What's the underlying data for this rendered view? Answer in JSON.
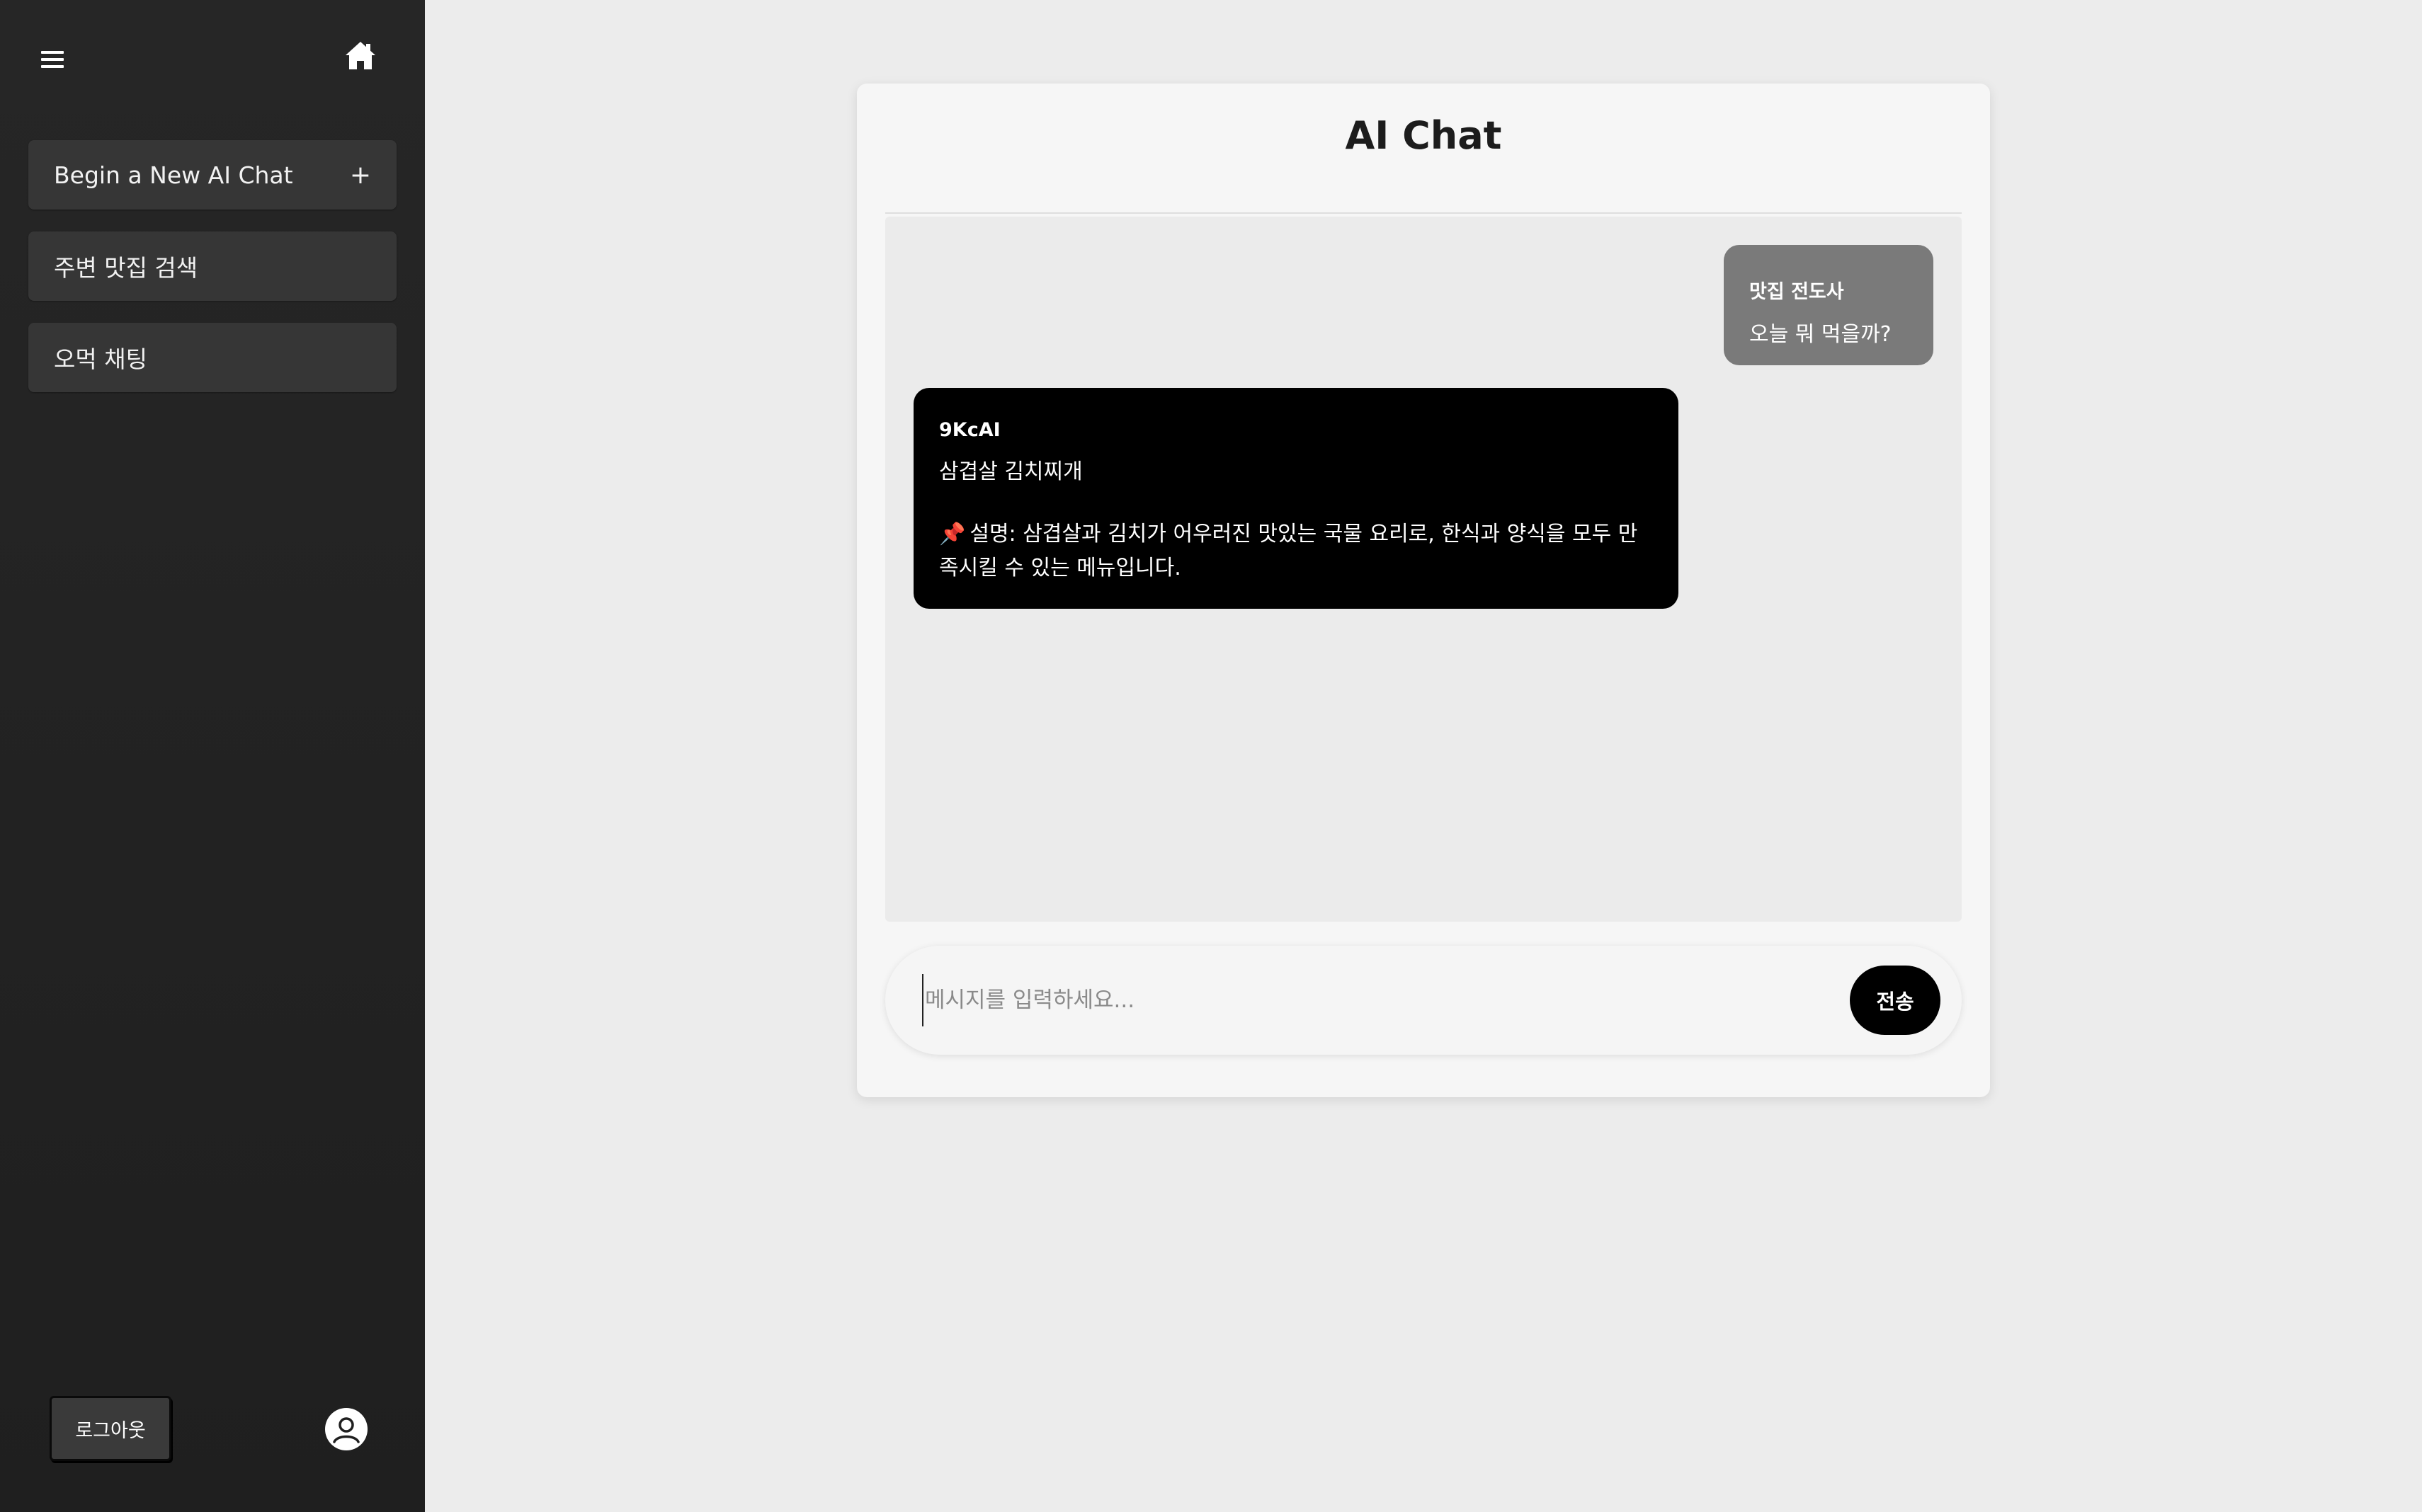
{
  "sidebar": {
    "menu_icon": "hamburger-menu-icon",
    "home_icon": "home-icon",
    "new_chat_label": "Begin a New AI Chat",
    "new_chat_plus": "+",
    "items": [
      {
        "label": "주변 맛집 검색"
      },
      {
        "label": "오먹 채팅"
      }
    ],
    "logout_label": "로그아웃",
    "avatar_icon": "user-avatar-icon"
  },
  "chat": {
    "title": "AI Chat",
    "messages": [
      {
        "sender": "맛집 전도사",
        "text": "오늘 뭐 먹을까?"
      },
      {
        "sender": "9KcAI",
        "dish": "삼겹살 김치찌개",
        "pin_icon": "📌",
        "description": "설명: 삼겹살과 김치가 어우러진 맛있는 국물 요리로, 한식과 양식을 모두 만족시킬 수 있는 메뉴입니다."
      }
    ],
    "input": {
      "placeholder": "메시지를 입력하세요...",
      "value": ""
    },
    "send_label": "전송"
  },
  "colors": {
    "sidebar_bg": "#262626",
    "sidebar_button_bg": "#363636",
    "main_bg": "#ececec",
    "card_bg": "#f6f6f6",
    "user_bubble": "#7a7a7a",
    "ai_bubble": "#000000",
    "send_button": "#000000"
  }
}
